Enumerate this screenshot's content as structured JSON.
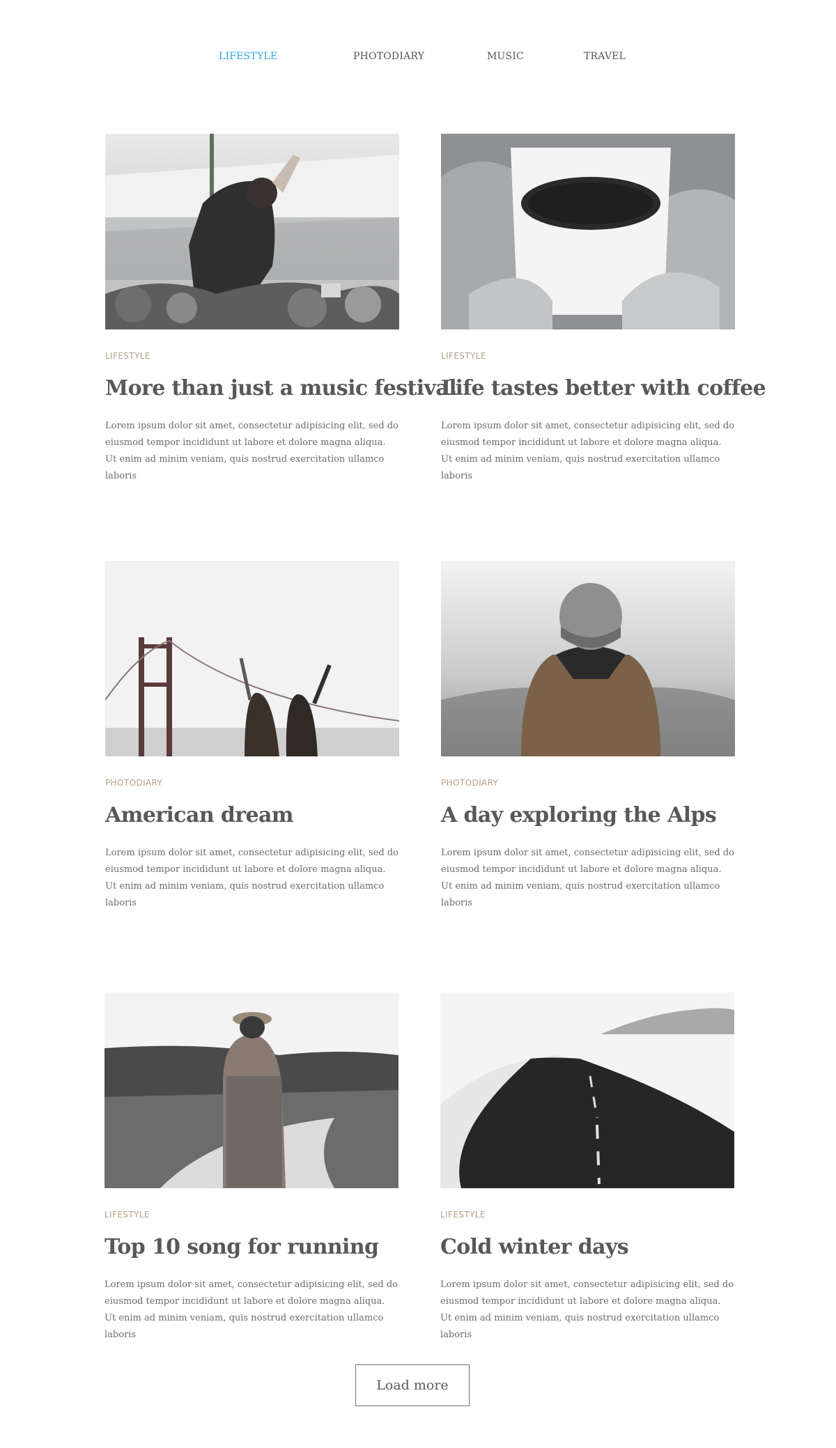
{
  "nav": {
    "items": [
      {
        "label": "LIFESTYLE",
        "active": true
      },
      {
        "label": "PHOTODIARY",
        "active": false
      },
      {
        "label": "MUSIC",
        "active": false
      },
      {
        "label": "TRAVEL",
        "active": false
      }
    ],
    "active_color": "#2aa7e6"
  },
  "posts": [
    {
      "category": "LIFESTYLE",
      "title": "More than just a music festival",
      "excerpt": "Lorem ipsum dolor sit amet, consectetur adipisicing elit, sed do eiusmod tempor incididunt ut labore et dolore magna aliqua. Ut enim ad minim veniam, quis nostrud exercitation ullamco laboris",
      "image": "festival-crowd-photo"
    },
    {
      "category": "LIFESTYLE",
      "title": "Life tastes better with coffee",
      "excerpt": "Lorem ipsum dolor sit amet, consectetur adipisicing elit, sed do eiusmod tempor incididunt ut labore et dolore magna aliqua. Ut enim ad minim veniam, quis nostrud exercitation ullamco laboris",
      "image": "coffee-cup-photo"
    },
    {
      "category": "PHOTODIARY",
      "title": "American dream",
      "excerpt": "Lorem ipsum dolor sit amet, consectetur adipisicing elit, sed do eiusmod tempor incididunt ut labore et dolore magna aliqua. Ut enim ad minim veniam, quis nostrud exercitation ullamco laboris",
      "image": "golden-gate-friends-photo"
    },
    {
      "category": "PHOTODIARY",
      "title": "A day exploring the Alps",
      "excerpt": "Lorem ipsum dolor sit amet, consectetur adipisicing elit, sed do eiusmod tempor incididunt ut labore et dolore magna aliqua. Ut enim ad minim veniam, quis nostrud exercitation ullamco laboris",
      "image": "hiker-beanie-photo"
    },
    {
      "category": "LIFESTYLE",
      "title": "Top 10 song for running",
      "excerpt": "Lorem ipsum dolor sit amet, consectetur adipisicing elit, sed do eiusmod tempor incididunt ut labore et dolore magna aliqua. Ut enim ad minim veniam, quis nostrud exercitation ullamco laboris",
      "image": "woman-path-photo"
    },
    {
      "category": "LIFESTYLE",
      "title": "Cold winter days",
      "excerpt": "Lorem ipsum dolor sit amet, consectetur adipisicing elit, sed do eiusmod tempor incididunt ut labore et dolore magna aliqua. Ut enim ad minim veniam, quis nostrud exercitation ullamco laboris",
      "image": "winter-road-photo"
    }
  ],
  "load_more": {
    "label": "Load more"
  },
  "colors": {
    "category": "#b59f85",
    "title": "#585858",
    "text": "#6a6a6a"
  }
}
